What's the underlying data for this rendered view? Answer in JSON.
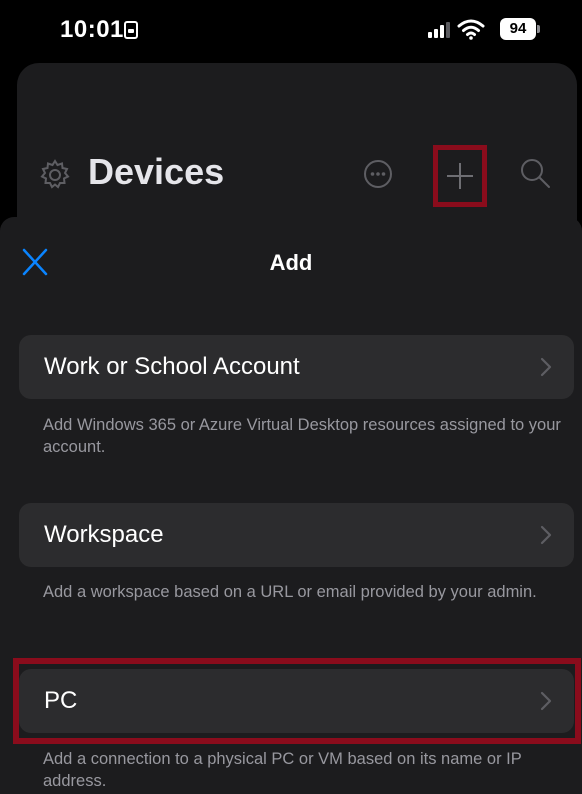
{
  "status_bar": {
    "time": "10:01",
    "battery": "94"
  },
  "background": {
    "title": "Devices"
  },
  "sheet": {
    "title": "Add",
    "items": [
      {
        "label": "Work or School Account",
        "description": "Add Windows 365 or Azure Virtual Desktop resources assigned to your account."
      },
      {
        "label": "Workspace",
        "description": "Add a workspace based on a URL or email provided by your admin."
      },
      {
        "label": "PC",
        "description": "Add a connection to a physical PC or VM based on its name or IP address."
      }
    ]
  },
  "colors": {
    "accent": "#0a84ff",
    "highlight": "#8a0c1c",
    "sheet_background": "#1c1c1e",
    "row_background": "#2c2c2e",
    "secondary_text": "#98989f"
  },
  "icons": [
    "status-badge-icon",
    "signal-icon",
    "wifi-icon",
    "battery-icon",
    "gear-icon",
    "more-icon",
    "plus-icon",
    "search-icon",
    "close-icon",
    "chevron-right-icon"
  ]
}
